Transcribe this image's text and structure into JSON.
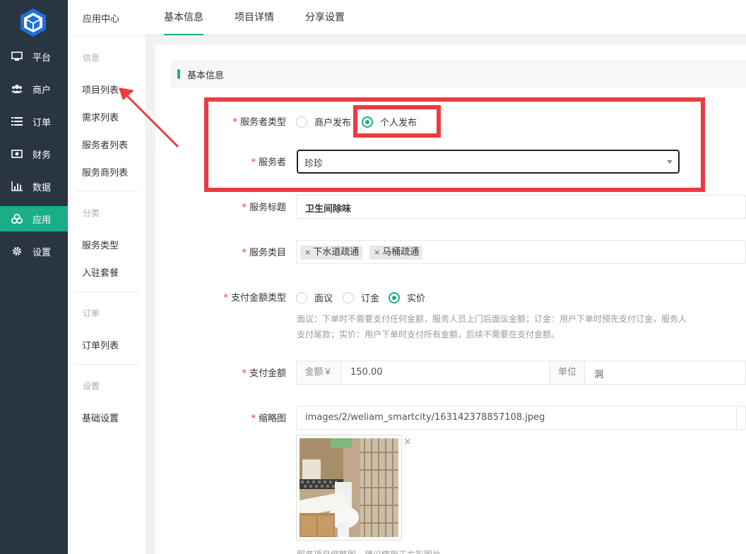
{
  "nav": {
    "items": [
      {
        "label": "平台",
        "icon": "monitor-icon"
      },
      {
        "label": "商户",
        "icon": "users-icon"
      },
      {
        "label": "订单",
        "icon": "list-icon"
      },
      {
        "label": "财务",
        "icon": "money-icon"
      },
      {
        "label": "数据",
        "icon": "bar-chart-icon"
      },
      {
        "label": "应用",
        "icon": "apps-icon"
      },
      {
        "label": "设置",
        "icon": "gear-icon"
      }
    ],
    "active_index": 5,
    "accent": "#1aae88",
    "background": "#2a3542"
  },
  "sidebar": {
    "heading": "应用中心",
    "groups": [
      {
        "title": "信息",
        "items": [
          "项目列表",
          "需求列表",
          "服务者列表",
          "服务商列表"
        ]
      },
      {
        "title": "分类",
        "items": [
          "服务类型",
          "入驻套餐"
        ]
      },
      {
        "title": "订单",
        "items": [
          "订单列表"
        ]
      },
      {
        "title": "设置",
        "items": [
          "基础设置"
        ]
      }
    ]
  },
  "tabs": [
    {
      "label": "基本信息",
      "active": true
    },
    {
      "label": "项目详情",
      "active": false
    },
    {
      "label": "分享设置",
      "active": false
    }
  ],
  "section": {
    "title": "基本信息"
  },
  "form": {
    "provider_type": {
      "label": "服务者类型",
      "options": [
        "商户发布",
        "个人发布"
      ],
      "selected": "个人发布"
    },
    "provider": {
      "label": "服务者",
      "value": "珍珍"
    },
    "title": {
      "label": "服务标题",
      "value": "卫生间除味"
    },
    "category": {
      "label": "服务类目",
      "tags": [
        "下水道疏通",
        "马桶疏通"
      ],
      "remove_glyph": "×"
    },
    "pay_type": {
      "label": "支付金额类型",
      "options": [
        "面议",
        "订金",
        "实价"
      ],
      "selected": "实价",
      "help_line1": "面议：下单时不需要支付任何金额，服务人员上门后面议金额；订金：用户下单时预先支付订金，服务人",
      "help_line2": "支付尾款；实价：用户下单时支付所有金额，后续不需要在支付金额。"
    },
    "amount": {
      "label": "支付金额",
      "prefix": "金额￥",
      "value": "150.00",
      "unit_label": "单位",
      "unit_value": "洞"
    },
    "thumbnail": {
      "label": "缩略图",
      "path": "images/2/weliam_smartcity/163142378857108.jpeg",
      "close_glyph": "×",
      "help": "服务项目缩略图，建议使用正方形图片"
    }
  },
  "annotation_color": "#ec3b3f"
}
